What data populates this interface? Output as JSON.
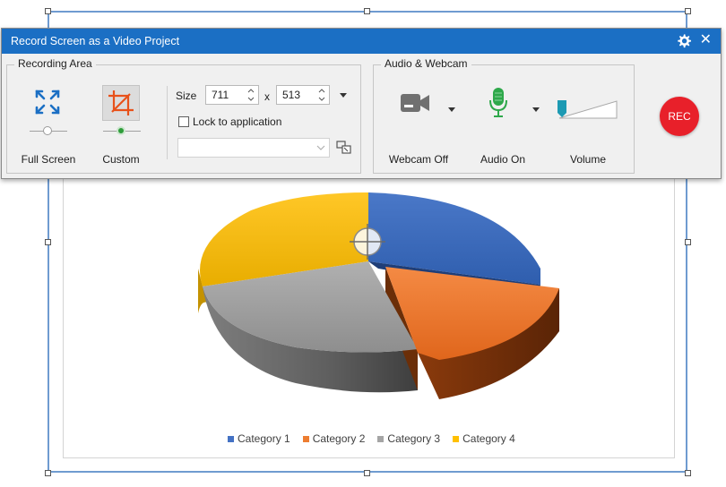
{
  "toolbar": {
    "title": "Record Screen as a Video Project",
    "icons": {
      "settings": "gear-icon",
      "close": "close-icon"
    }
  },
  "recording_area": {
    "group_title": "Recording Area",
    "full_screen_label": "Full Screen",
    "custom_label": "Custom",
    "size_label": "Size",
    "width": "711",
    "times": "x",
    "height": "513",
    "lock_label": "Lock to application",
    "lock_checked": false,
    "application_select": ""
  },
  "audio_webcam": {
    "group_title": "Audio & Webcam",
    "webcam_label": "Webcam Off",
    "audio_label": "Audio On",
    "volume_label": "Volume"
  },
  "rec_label": "REC",
  "chart_data": {
    "type": "pie",
    "style": "3d-exploded",
    "categories": [
      "Category 1",
      "Category 2",
      "Category 3",
      "Category 4"
    ],
    "values": [
      26,
      17,
      32,
      25
    ],
    "colors": [
      "#4472c4",
      "#ed7d31",
      "#a5a5a5",
      "#ffc000"
    ],
    "legend": "bottom"
  },
  "legend": [
    "Category 1",
    "Category 2",
    "Category 3",
    "Category 4"
  ],
  "colors": {
    "accent": "#1b6fc4",
    "region_border": "#6f9bd0",
    "rec": "#e8202a"
  }
}
